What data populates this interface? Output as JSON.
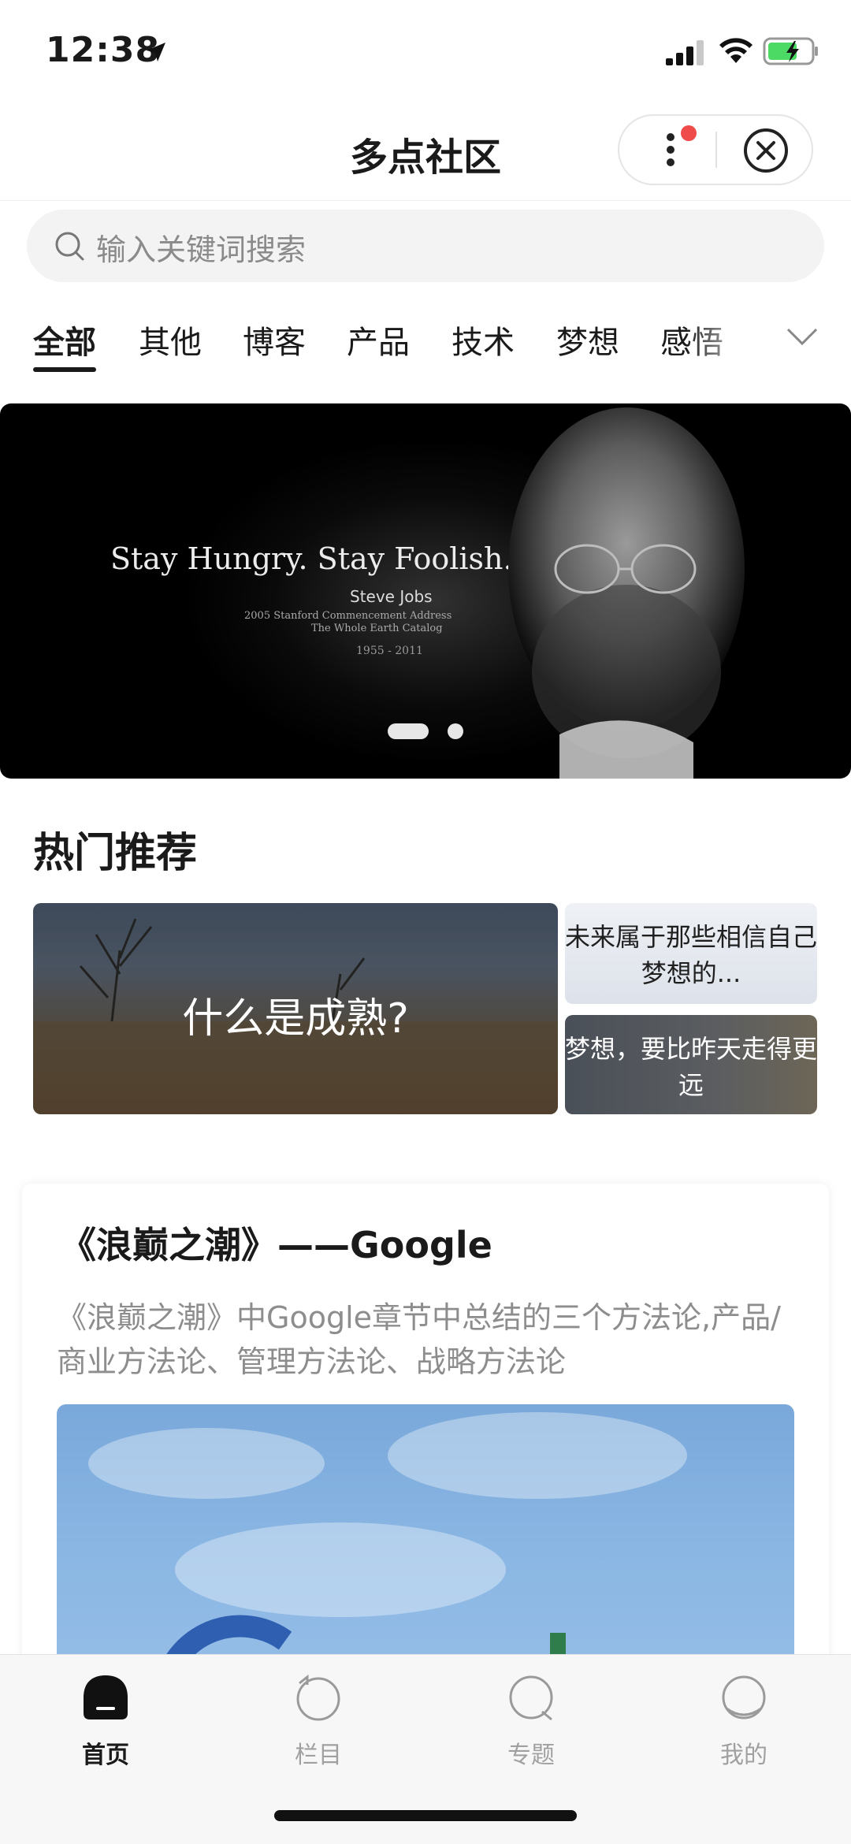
{
  "status_bar": {
    "time": "12:38"
  },
  "header": {
    "title": "多点社区"
  },
  "search": {
    "placeholder": "输入关键词搜索"
  },
  "tabs": [
    {
      "label": "全部",
      "active": true
    },
    {
      "label": "其他"
    },
    {
      "label": "博客"
    },
    {
      "label": "产品"
    },
    {
      "label": "技术"
    },
    {
      "label": "梦想"
    },
    {
      "label": "感悟"
    }
  ],
  "banner": {
    "quote": "Stay Hungry. Stay Foolish.",
    "name": "Steve Jobs",
    "sub1": "2005 Stanford Commencement Address",
    "sub2": "The Whole Earth Catalog",
    "years": "1955 - 2011",
    "slide_count": 2,
    "active_slide": 1
  },
  "hot": {
    "title": "热门推荐",
    "main": "什么是成熟?",
    "side1": "未来属于那些相信自己梦想的...",
    "side2": "梦想，要比昨天走得更远"
  },
  "article": {
    "title": "《浪巅之潮》——Google",
    "description": "《浪巅之潮》中Google章节中总结的三个方法论,产品/商业方法论、管理方法论、战略方法论"
  },
  "tabbar": [
    {
      "label": "首页",
      "active": true,
      "icon": "home-icon"
    },
    {
      "label": "栏目",
      "icon": "column-icon"
    },
    {
      "label": "专题",
      "icon": "topic-icon"
    },
    {
      "label": "我的",
      "icon": "profile-icon"
    }
  ],
  "colors": {
    "badge": "#ef4b4b",
    "battery": "#4cd964",
    "text": "#1a1a1a"
  }
}
